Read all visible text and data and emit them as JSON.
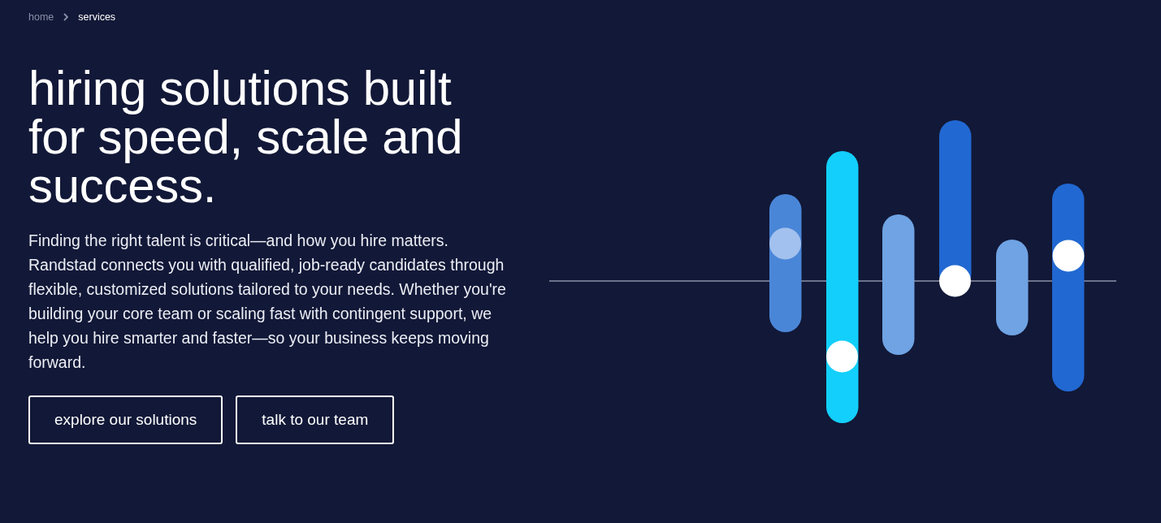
{
  "breadcrumb": [
    {
      "label": "home",
      "current": false
    },
    {
      "label": "services",
      "current": true
    }
  ],
  "hero": {
    "heading": "hiring solutions built for speed, scale and success.",
    "description": "Finding the right talent is critical—and how you hire matters. Randstad connects you with qualified, job-ready candidates through flexible, customized solutions tailored to your needs. Whether you're building your core team or scaling fast with contingent support, we help you hire smarter and faster—so your business keeps moving forward.",
    "buttons": [
      {
        "label": "explore our solutions"
      },
      {
        "label": "talk to our team"
      }
    ]
  }
}
